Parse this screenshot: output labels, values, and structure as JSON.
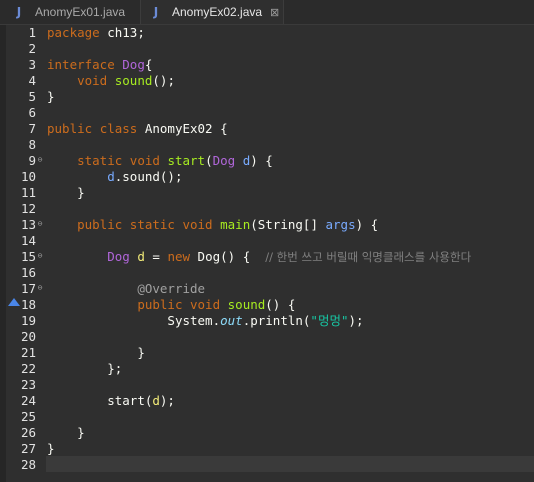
{
  "tabs": [
    {
      "label": "AnomyEx01.java",
      "icon": "java-file-icon",
      "active": false
    },
    {
      "label": "AnomyEx02.java",
      "icon": "java-file-icon",
      "active": true
    }
  ],
  "tab_close_glyph": "⊠",
  "tab_icon_glyph": "J",
  "line_numbers": [
    "1",
    "2",
    "3",
    "4",
    "5",
    "6",
    "7",
    "8",
    "9",
    "10",
    "11",
    "12",
    "13",
    "14",
    "15",
    "16",
    "17",
    "18",
    "19",
    "20",
    "21",
    "22",
    "23",
    "24",
    "25",
    "26",
    "27",
    "28"
  ],
  "code": {
    "l1_kw": "package",
    "l1_rest": " ch13;",
    "l3_kw": "interface",
    "l3_name": "Dog",
    "l3_rest": "{",
    "l4_kw": "void",
    "l4_fn": "sound",
    "l4_rest": "();",
    "l5": "}",
    "l7_kw1": "public",
    "l7_kw2": "class",
    "l7_name": " AnomyEx02 {",
    "l9_kw1": "static",
    "l9_kw2": "void",
    "l9_fn": "start",
    "l9_p1": "(",
    "l9_type": "Dog",
    "l9_param": "d",
    "l9_rest": ") {",
    "l10_var": "d",
    "l10_rest": ".sound();",
    "l11": "}",
    "l13_kw1": "public",
    "l13_kw2": "static",
    "l13_kw3": "void",
    "l13_fn": "main",
    "l13_p1": "(String[] ",
    "l13_param": "args",
    "l13_rest": ") {",
    "l15_type": "Dog",
    "l15_var": "d",
    "l15_eq": " = ",
    "l15_kw": "new",
    "l15_rest": " Dog() {  ",
    "l15_comment": "// 한번 쓰고 버릴때 익명클래스를 사용한다",
    "l17_anno": "@Override",
    "l18_kw1": "public",
    "l18_kw2": "void",
    "l18_fn": "sound",
    "l18_rest": "() {",
    "l19_a": "System.",
    "l19_field": "out",
    "l19_b": ".println(",
    "l19_str": "\"멍멍\"",
    "l19_c": ");",
    "l21": "}",
    "l22": "};",
    "l24_a": "start(",
    "l24_var": "d",
    "l24_b": ");",
    "l26": "}",
    "l27": "}"
  },
  "colors": {
    "keyword": "#cc6c1d",
    "interface_name": "#b166da",
    "method": "#a7ec21",
    "parameter": "#79abff",
    "local_variable": "#f3ec79",
    "string": "#17c6a3",
    "comment": "#808080",
    "annotation": "#a0a0a0",
    "field": "#8ddaf8",
    "background": "#2f2f2f"
  }
}
